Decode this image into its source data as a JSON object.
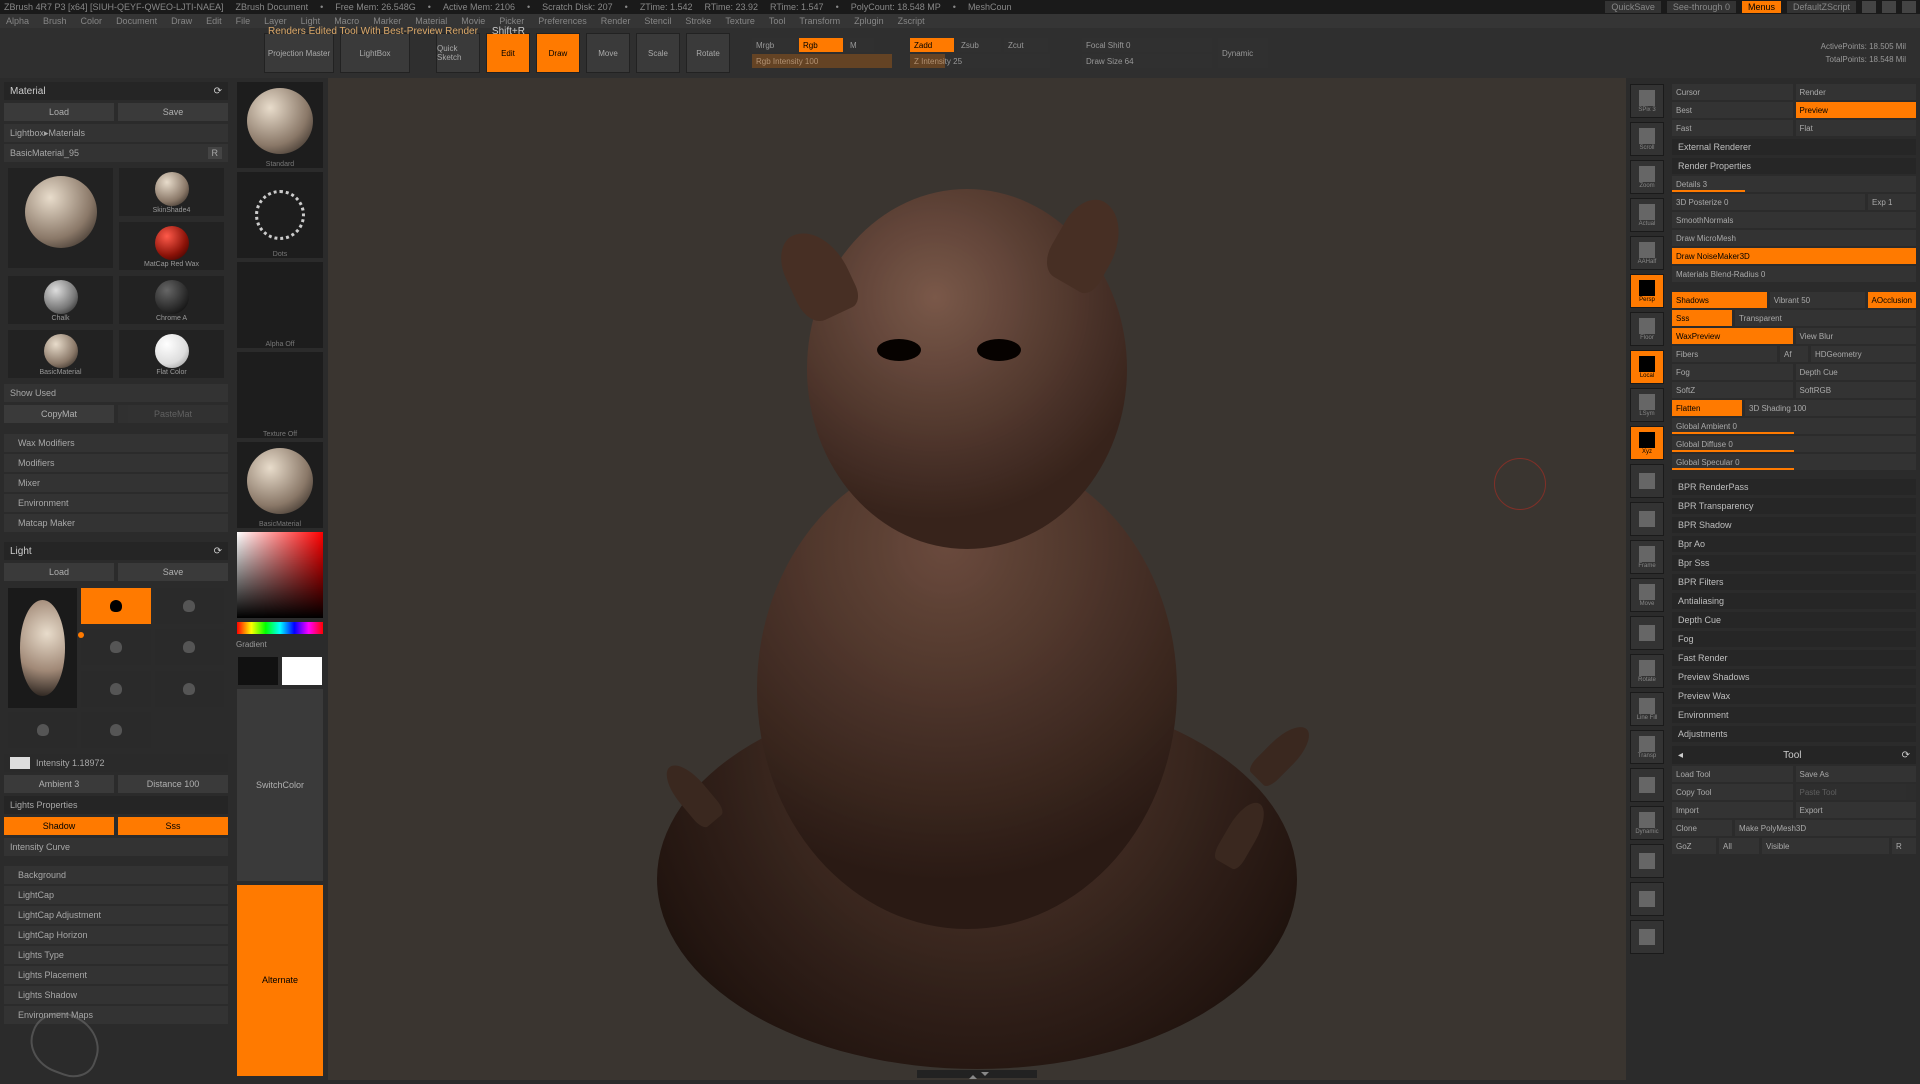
{
  "title_segments": [
    "ZBrush 4R7 P3 [x64] [SIUH-QEYF-QWEO-LJTI-NAEA]",
    "ZBrush Document",
    "Free Mem: 26.548G",
    "Active Mem: 2106",
    "Scratch Disk: 207",
    "ZTime: 1.542",
    "RTime: 23.92",
    "RTime: 1.547",
    "PolyCount: 18.548 MP",
    "MeshCoun"
  ],
  "title_right": {
    "quicksave": "QuickSave",
    "seethrough": "See-through  0",
    "menus": "Menus",
    "script": "DefaultZScript"
  },
  "menubar": [
    "Alpha",
    "Brush",
    "Color",
    "Document",
    "Draw",
    "Edit",
    "File",
    "Layer",
    "Light",
    "Macro",
    "Marker",
    "Material",
    "Movie",
    "Picker",
    "Preferences",
    "Render",
    "Stencil",
    "Stroke",
    "Texture",
    "Tool",
    "Transform",
    "Zplugin",
    "Zscript"
  ],
  "status": {
    "text": "Renders Edited Tool With Best-Preview Render",
    "shortcut": "Shift+R"
  },
  "toolbar": {
    "projection": "Projection Master",
    "lightbox": "LightBox",
    "quick": "Quick Sketch",
    "edit": "Edit",
    "draw": "Draw",
    "move": "Move",
    "scale": "Scale",
    "rotate": "Rotate",
    "mrgb": "Mrgb",
    "rgb": "Rgb",
    "m": "M",
    "rgb_int": "Rgb Intensity 100",
    "zadd": "Zadd",
    "zsub": "Zsub",
    "zcut": "Zcut",
    "zint": "Z Intensity 25",
    "focal": "Focal Shift 0",
    "draw_size": "Draw Size 64",
    "dynamic": "Dynamic",
    "active": "ActivePoints: 18.505 Mil",
    "total": "TotalPoints: 18.548 Mil"
  },
  "material": {
    "header": "Material",
    "load": "Load",
    "save": "Save",
    "lightbox": "Lightbox▸Materials",
    "current": "BasicMaterial_95",
    "r": "R",
    "sw": [
      "SkinShade4",
      "MatCap Red Wax",
      "Chalk",
      "Chrome A",
      "BasicMaterial",
      "Flat Color"
    ],
    "show_used": "Show Used",
    "copy": "CopyMat",
    "paste": "PasteMat",
    "sections": [
      "Wax Modifiers",
      "Modifiers",
      "Mixer",
      "Environment",
      "Matcap Maker"
    ]
  },
  "light": {
    "header": "Light",
    "load": "Load",
    "save": "Save",
    "intensity": "Intensity 1.18972",
    "ambient": "Ambient 3",
    "distance": "Distance 100",
    "props": "Lights Properties",
    "shadow": "Shadow",
    "sss": "Sss",
    "curve": "Intensity Curve",
    "sections": [
      "Background",
      "LightCap",
      "LightCap Adjustment",
      "LightCap Horizon",
      "Lights Type",
      "Lights Placement",
      "Lights Shadow",
      "Environment Maps"
    ]
  },
  "shelf": {
    "standard": "Standard",
    "dots": "Dots",
    "alpha": "Alpha Off",
    "texture": "Texture Off",
    "basic": "BasicMaterial",
    "gradient": "Gradient",
    "switch": "SwitchColor",
    "alternate": "Alternate"
  },
  "rstrip": [
    "SPix 3",
    "Scroll",
    "Zoom",
    "Actual",
    "AAHalf",
    "Persp",
    "Floor",
    "Local",
    "LSym",
    "Xyz",
    "",
    "",
    "Frame",
    "Move",
    "",
    "Rotate",
    "Line Fill",
    "Transp",
    "",
    "Dynamic",
    "",
    "",
    ""
  ],
  "rstrip_orange": [
    5,
    7,
    9
  ],
  "right_top": {
    "cursor": "Cursor",
    "render": "Render",
    "best": "Best",
    "preview": "Preview",
    "fast": "Fast",
    "flat": "Flat",
    "ext": "External Renderer",
    "props": "Render Properties"
  },
  "render_props": {
    "details": "Details 3",
    "posterize": "3D Posterize 0",
    "exp": "Exp 1",
    "smooth": "SmoothNormals",
    "micro": "Draw MicroMesh",
    "noise": "Draw NoiseMaker3D",
    "blend": "Materials Blend-Radius 0",
    "shadows": "Shadows",
    "vibrant": "Vibrant 50",
    "ao": "AOcclusion",
    "sss": "Sss",
    "transparent": "Transparent",
    "wax": "WaxPreview",
    "blur": "View Blur",
    "fibers": "Fibers",
    "af": "Af",
    "hd": "HDGeometry",
    "fog": "Fog",
    "depth": "Depth Cue",
    "softz": "SoftZ",
    "softrgb": "SoftRGB",
    "flatten": "Flatten",
    "shading": "3D Shading 100",
    "gamb": "Global Ambient 0",
    "gdiff": "Global Diffuse 0",
    "gspec": "Global Specular 0"
  },
  "render_sections": [
    "BPR RenderPass",
    "BPR Transparency",
    "BPR Shadow",
    "Bpr Ao",
    "Bpr Sss",
    "BPR Filters",
    "Antialiasing",
    "Depth Cue",
    "Fog",
    "Fast Render",
    "Preview Shadows",
    "Preview Wax",
    "Environment",
    "Adjustments"
  ],
  "tool": {
    "header": "Tool",
    "load": "Load Tool",
    "saveas": "Save As",
    "copy": "Copy Tool",
    "paste": "Paste Tool",
    "import": "Import",
    "export": "Export",
    "clone": "Clone",
    "make": "Make PolyMesh3D",
    "goz": "GoZ",
    "all": "All",
    "visible": "Visible",
    "r": "R"
  }
}
